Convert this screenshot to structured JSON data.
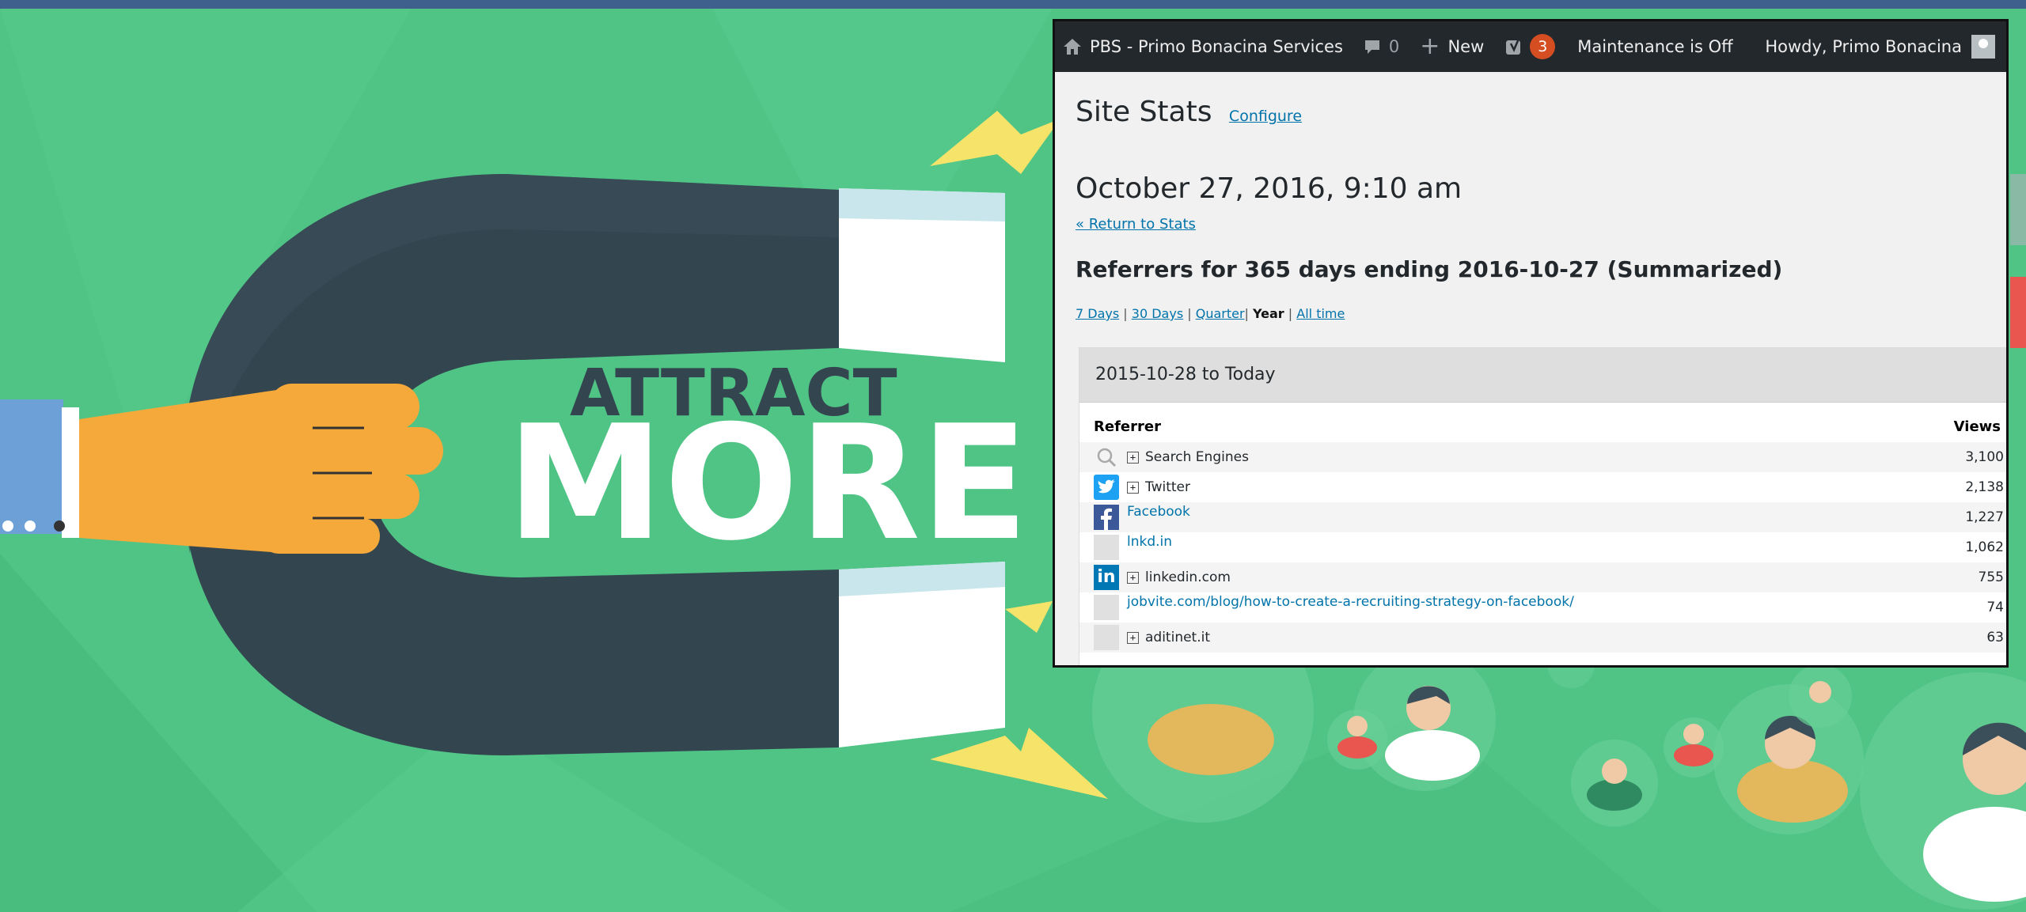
{
  "colors": {
    "background": "#4fc485",
    "magnet_body": "#33454f",
    "hand": "#f6a93b",
    "bolt": "#f6e36a",
    "admin_bar": "#23282d",
    "link": "#0073aa"
  },
  "banner": {
    "line1": "ATTRACT",
    "line2": "MORE"
  },
  "admin_bar": {
    "home_icon": "home-icon",
    "site_name": "PBS - Primo Bonacina Services",
    "comment_icon": "comment-bubble-icon",
    "comments_count": "0",
    "new_icon": "plus-icon",
    "new_label": "New",
    "yoast_icon": "yoast-icon",
    "yoast_badge": "3",
    "maintenance": "Maintenance is Off",
    "howdy": "Howdy, Primo Bonacina"
  },
  "page": {
    "title": "Site Stats",
    "configure": "Configure",
    "date": "October 27, 2016, 9:10 am",
    "return_link": "« Return to Stats",
    "heading": "Referrers for 365 days ending 2016-10-27 (Summarized)",
    "periods": {
      "d7": "7 Days",
      "d30": "30 Days",
      "quarter": "Quarter",
      "year": "Year",
      "all": "All time",
      "sep": "|"
    }
  },
  "table": {
    "range": "2015-10-28 to Today",
    "col_referrer": "Referrer",
    "col_views": "Views",
    "rows": [
      {
        "icon": "search-icon",
        "label": "Search Engines",
        "expand": true,
        "views": "3,100"
      },
      {
        "icon": "twitter-icon",
        "label": "Twitter",
        "expand": true,
        "views": "2,138"
      },
      {
        "icon": "facebook-icon",
        "label": "Facebook",
        "expand": false,
        "views": "1,227"
      },
      {
        "icon": "blank-icon",
        "label": "lnkd.in",
        "expand": false,
        "views": "1,062"
      },
      {
        "icon": "linkedin-icon",
        "label": "linkedin.com",
        "expand": true,
        "views": "755"
      },
      {
        "icon": "blank-icon",
        "label": "jobvite.com/blog/how-to-create-a-recruiting-strategy-on-facebook/",
        "expand": false,
        "views": "74"
      },
      {
        "icon": "blank-icon",
        "label": "aditinet.it",
        "expand": true,
        "views": "63"
      }
    ]
  }
}
